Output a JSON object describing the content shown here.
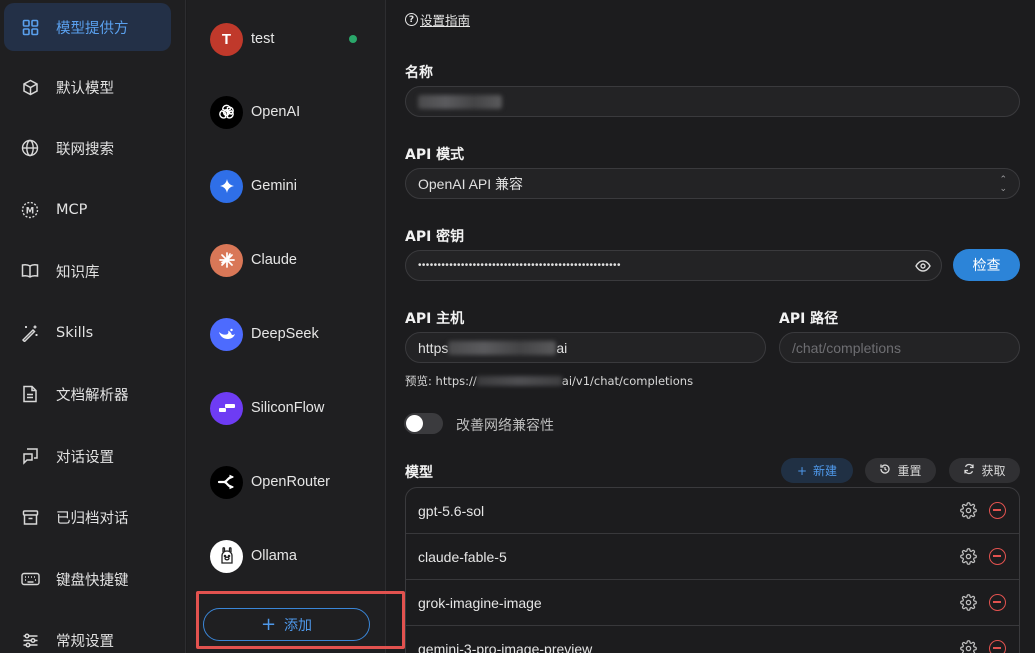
{
  "nav": {
    "items": [
      {
        "label": "模型提供方",
        "icon": "grid-icon",
        "active": true
      },
      {
        "label": "默认模型",
        "icon": "cube-icon"
      },
      {
        "label": "联网搜索",
        "icon": "globe-icon"
      },
      {
        "label": "MCP",
        "icon": "mcp-icon"
      },
      {
        "label": "知识库",
        "icon": "book-icon"
      },
      {
        "label": "Skills",
        "icon": "magic-wand-icon"
      },
      {
        "label": "文档解析器",
        "icon": "document-icon"
      },
      {
        "label": "对话设置",
        "icon": "chat-settings-icon"
      },
      {
        "label": "已归档对话",
        "icon": "archive-icon"
      },
      {
        "label": "键盘快捷键",
        "icon": "keyboard-icon"
      },
      {
        "label": "常规设置",
        "icon": "sliders-icon"
      }
    ]
  },
  "providers": {
    "items": [
      {
        "name": "test",
        "initial": "T",
        "color": "#c0392b",
        "enabled": true
      },
      {
        "name": "OpenAI",
        "icon": "openai-icon",
        "color": "#000000"
      },
      {
        "name": "Gemini",
        "icon": "gemini-icon",
        "color": "#2f6fe8"
      },
      {
        "name": "Claude",
        "icon": "claude-icon",
        "color": "#d97757"
      },
      {
        "name": "DeepSeek",
        "icon": "deepseek-icon",
        "color": "#4d6bfe"
      },
      {
        "name": "SiliconFlow",
        "icon": "siliconflow-icon",
        "color": "#6e3cf4"
      },
      {
        "name": "OpenRouter",
        "icon": "openrouter-icon",
        "color": "#000000"
      },
      {
        "name": "Ollama",
        "icon": "ollama-icon",
        "color": "#ffffff"
      }
    ],
    "add_label": "添加"
  },
  "main": {
    "guide_label": "设置指南",
    "name_label": "名称",
    "api_mode_label": "API 模式",
    "api_mode_value": "OpenAI API 兼容",
    "api_key_label": "API 密钥",
    "api_key_value": "••••••••••••••••••••••••••••••••••••••••••••••••••••",
    "check_label": "检查",
    "api_host_label": "API 主机",
    "api_host_prefix": "https",
    "api_host_suffix": "ai",
    "api_path_label": "API 路径",
    "api_path_placeholder": "/chat/completions",
    "preview_prefix": "预览: https://",
    "preview_suffix": "ai/v1/chat/completions",
    "toggle_label": "改善网络兼容性",
    "models_label": "模型",
    "new_label": "新建",
    "reset_label": "重置",
    "fetch_label": "获取",
    "models": [
      {
        "name": "gpt-5.6-sol"
      },
      {
        "name": "claude-fable-5"
      },
      {
        "name": "grok-imagine-image"
      },
      {
        "name": "gemini-3-pro-image-preview"
      }
    ]
  },
  "colors": {
    "accent": "#2c84d8",
    "danger": "#e2524f",
    "online": "#2aa76a"
  }
}
